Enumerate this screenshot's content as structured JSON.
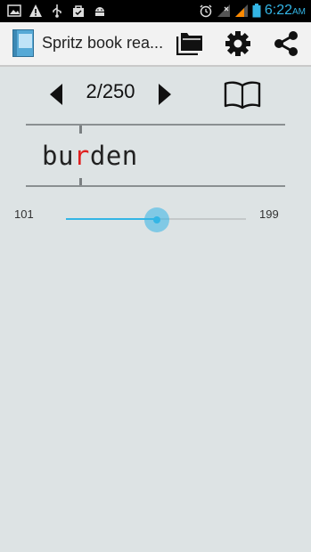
{
  "status_bar": {
    "time": "6:22",
    "ampm": "AM",
    "icons_left": [
      "gallery-icon",
      "warning-icon",
      "usb-icon",
      "bag-icon",
      "android-icon"
    ],
    "icons_right": [
      "alarm-icon",
      "signal-empty-icon",
      "signal-orange-icon",
      "battery-icon"
    ],
    "accent_color": "#33b5e5"
  },
  "action_bar": {
    "title": "Spritz book rea...",
    "actions": [
      "open-folder",
      "settings",
      "share"
    ]
  },
  "navigation": {
    "page_indicator": "2/250",
    "prev_icon": "triangle-left-icon",
    "next_icon": "triangle-right-icon",
    "book_icon": "open-book-icon"
  },
  "reader": {
    "word_before": "bu",
    "word_pivot": "r",
    "word_after": "den",
    "pivot_color": "#e02020"
  },
  "speed": {
    "min_label": "101",
    "max_label": "199",
    "position_fraction": 0.505
  }
}
